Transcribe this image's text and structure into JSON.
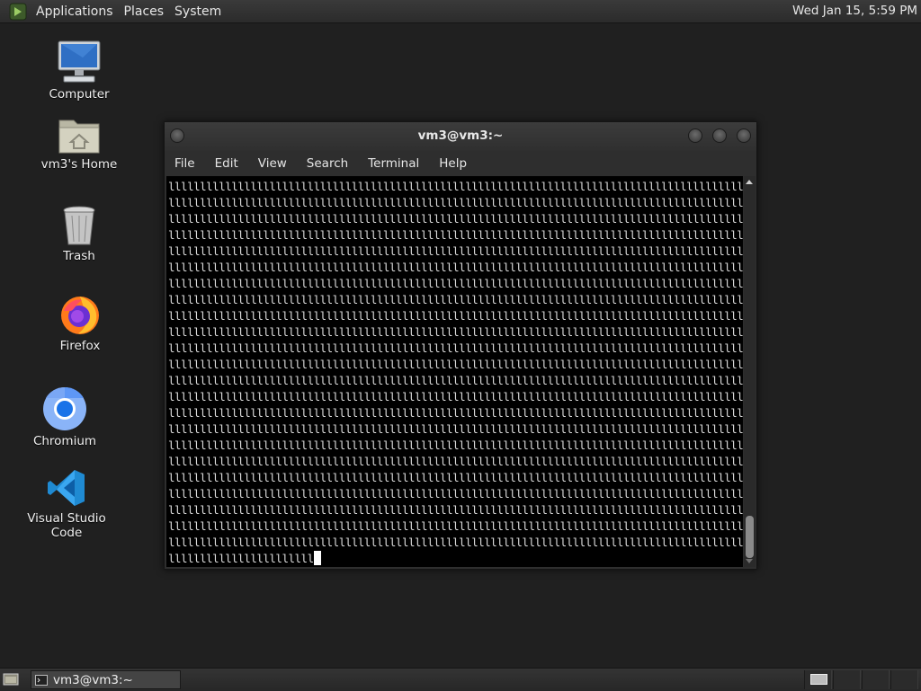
{
  "top_panel": {
    "menus": [
      "Applications",
      "Places",
      "System"
    ],
    "clock": "Wed Jan 15,  5:59 PM"
  },
  "desktop_icons": [
    {
      "label": "Computer",
      "icon": "computer-icon"
    },
    {
      "label": "vm3's Home",
      "icon": "home-folder-icon"
    },
    {
      "label": "Trash",
      "icon": "trash-icon"
    },
    {
      "label": "Firefox",
      "icon": "firefox-icon"
    },
    {
      "label": "Chromium",
      "icon": "chromium-icon"
    },
    {
      "label": "Visual Studio Code",
      "icon": "vscode-icon"
    }
  ],
  "terminal": {
    "title": "vm3@vm3:~",
    "menu": [
      "File",
      "Edit",
      "View",
      "Search",
      "Terminal",
      "Help"
    ],
    "full_line": "llllllllllllllllllllllllllllllllllllllllllllllllllllllllllllllllllllllllllllllllllllllllllllllllllllllll",
    "full_line_count": 23,
    "last_line": "lllllllllllllllllllllll"
  },
  "taskbar": {
    "task_label": "vm3@vm3:~"
  },
  "colors": {
    "desktop_bg": "#202020",
    "terminal_bg": "#000000",
    "terminal_fg": "#dcdcdc"
  }
}
